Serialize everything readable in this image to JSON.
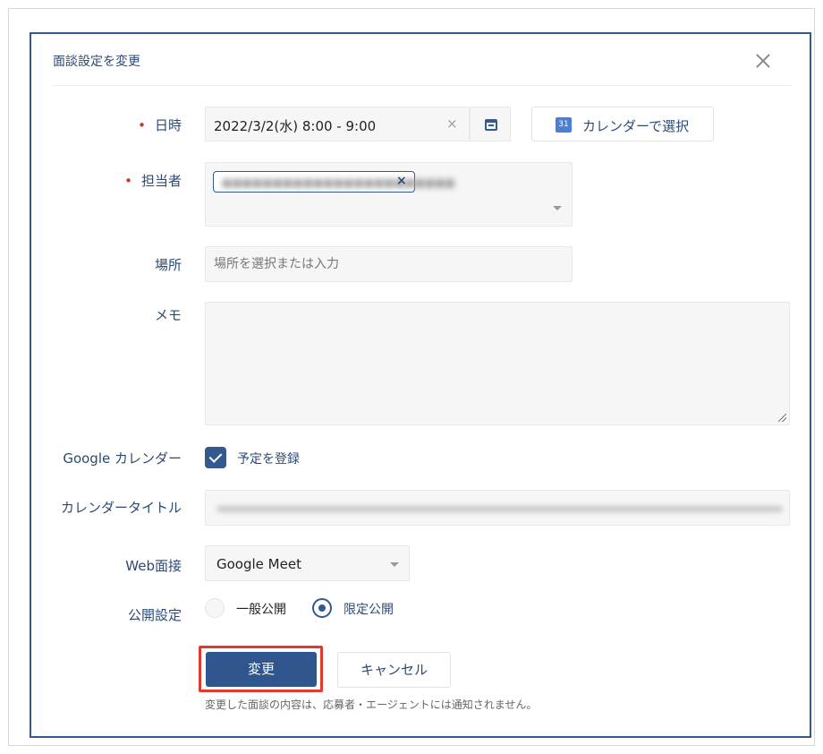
{
  "dialog": {
    "title": "面談設定を変更"
  },
  "form": {
    "datetime": {
      "label": "日時",
      "value": "2022/3/2(水) 8:00 - 9:00",
      "clear_symbol": "×",
      "calendar_button_label": "カレンダーで選択",
      "calendar_icon_text": "31"
    },
    "staff": {
      "label": "担当者",
      "chip_name": "■■■■■■■■■■■■■■■■■■■■■■■",
      "chip_remove_symbol": "×"
    },
    "place": {
      "label": "場所",
      "placeholder": "場所を選択または入力"
    },
    "memo": {
      "label": "メモ"
    },
    "google_calendar": {
      "label": "Google カレンダー",
      "checkbox_label": "予定を登録",
      "checked": true
    },
    "calendar_title": {
      "label": "カレンダータイトル"
    },
    "web_interview": {
      "label": "Web面接",
      "selected": "Google Meet"
    },
    "visibility": {
      "label": "公開設定",
      "options": [
        "一般公開",
        "限定公開"
      ],
      "selected": "限定公開"
    }
  },
  "actions": {
    "submit_label": "変更",
    "cancel_label": "キャンセル",
    "note": "変更した面談の内容は、応募者・エージェントには通知されません。"
  },
  "colors": {
    "primary": "#2f568f",
    "border_accent": "#34598c",
    "required": "#c0392b",
    "highlight": "#e03a2f"
  }
}
